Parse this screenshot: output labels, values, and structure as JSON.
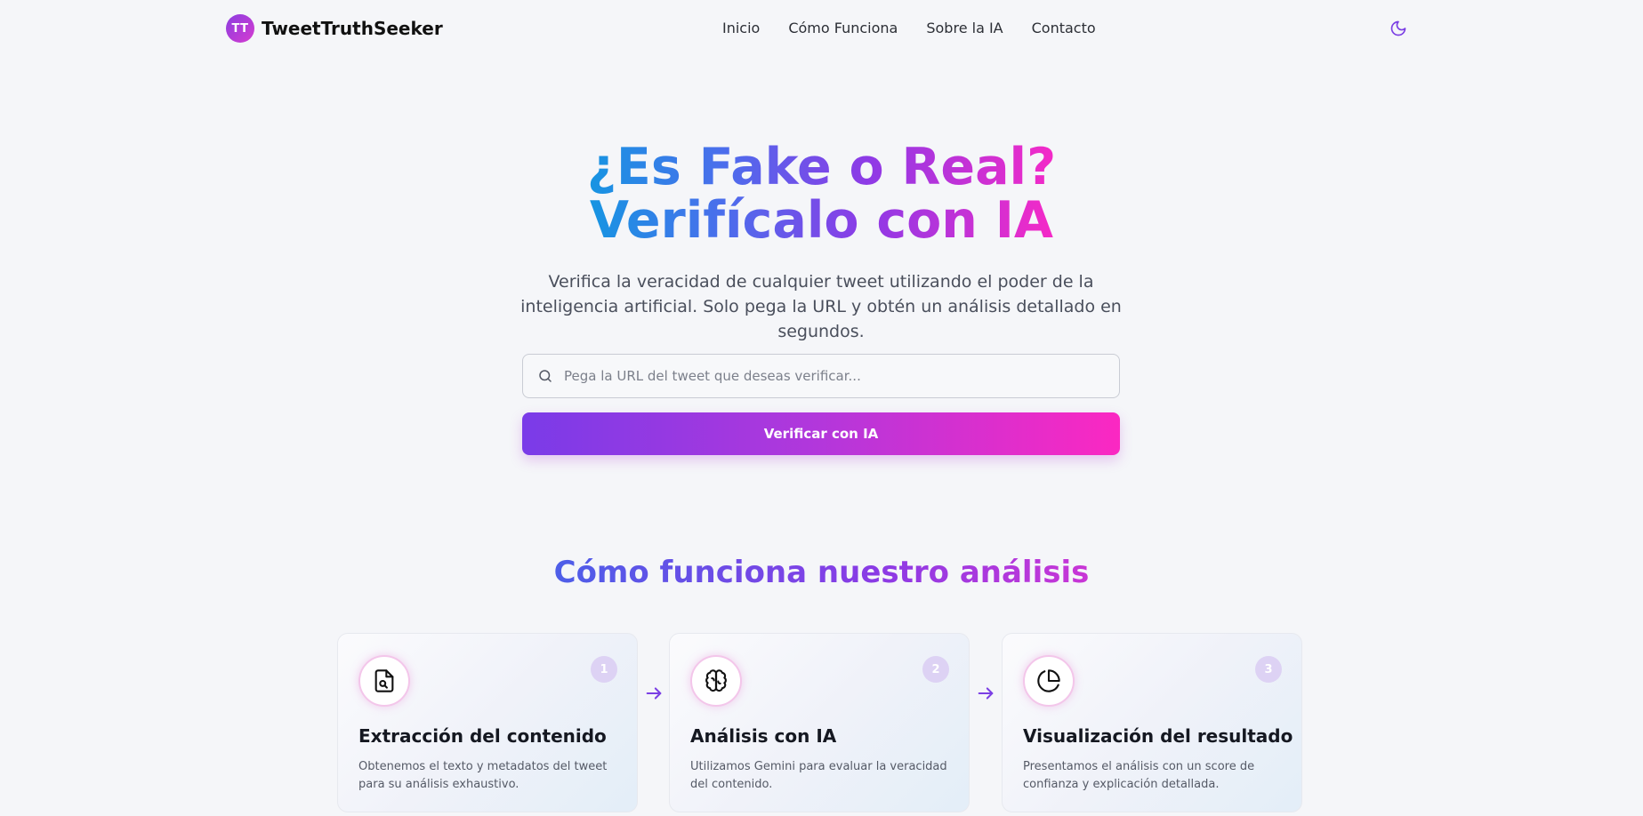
{
  "header": {
    "logo_initials": "TT",
    "brand_name": "TweetTruthSeeker",
    "nav": [
      "Inicio",
      "Cómo Funciona",
      "Sobre la IA",
      "Contacto"
    ],
    "theme_toggle_icon": "moon-icon"
  },
  "hero": {
    "title_line1": "¿Es Fake o Real?",
    "title_line2": "Verifícalo con IA",
    "subtitle": "Verifica la veracidad de cualquier tweet utilizando el poder de la inteligencia artificial. Solo pega la URL y obtén un análisis detallado en segundos.",
    "search_placeholder": "Pega la URL del tweet que deseas verificar...",
    "search_value": "",
    "verify_button": "Verificar con IA"
  },
  "how_it_works": {
    "title": "Cómo funciona nuestro análisis",
    "steps": [
      {
        "number": "1",
        "icon": "file-search-icon",
        "title": "Extracción del contenido",
        "description": "Obtenemos el texto y metadatos del tweet para su análisis exhaustivo."
      },
      {
        "number": "2",
        "icon": "brain-icon",
        "title": "Análisis con IA",
        "description": "Utilizamos Gemini para evaluar la veracidad del contenido."
      },
      {
        "number": "3",
        "icon": "pie-chart-icon",
        "title": "Visualización del resultado",
        "description": "Presentamos el análisis con un score de confianza y explicación detallada."
      }
    ]
  },
  "colors": {
    "background": "#f5f6f9",
    "accent_purple": "#7a3be8",
    "accent_pink": "#fb28c2",
    "accent_blue": "#1695e2"
  }
}
